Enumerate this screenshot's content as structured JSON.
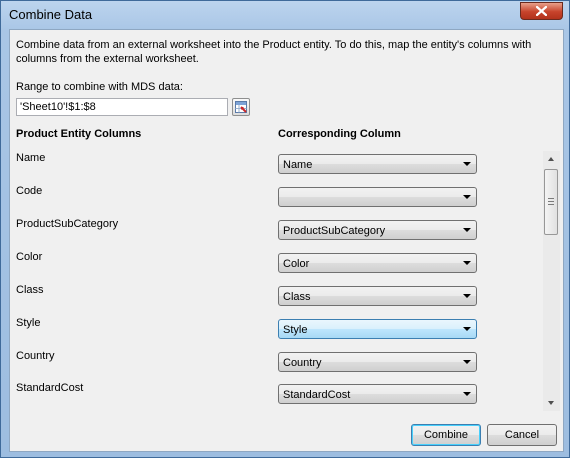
{
  "window": {
    "title": "Combine Data"
  },
  "description": "Combine data from an external worksheet into the Product entity. To do this, map the entity's columns with columns from the external worksheet.",
  "range": {
    "label": "Range to combine with MDS data:",
    "value": "'Sheet10'!$1:$8"
  },
  "columns": {
    "left_header": "Product Entity Columns",
    "right_header": "Corresponding Column"
  },
  "rows": [
    {
      "label": "Name",
      "value": "Name"
    },
    {
      "label": "Code",
      "value": ""
    },
    {
      "label": "ProductSubCategory",
      "value": "ProductSubCategory"
    },
    {
      "label": "Color",
      "value": "Color"
    },
    {
      "label": "Class",
      "value": "Class"
    },
    {
      "label": "Style",
      "value": "Style",
      "focused": true
    },
    {
      "label": "Country",
      "value": "Country"
    },
    {
      "label": "StandardCost",
      "value": "StandardCost"
    }
  ],
  "buttons": {
    "combine": "Combine",
    "cancel": "Cancel"
  },
  "icons": {
    "close": "close-icon",
    "range_select": "range-select-icon",
    "dropdown": "chevron-down-icon"
  },
  "colors": {
    "title_bar": "#a9c6e6",
    "close_button": "#c7432b",
    "focus_border": "#3c7fb1"
  }
}
